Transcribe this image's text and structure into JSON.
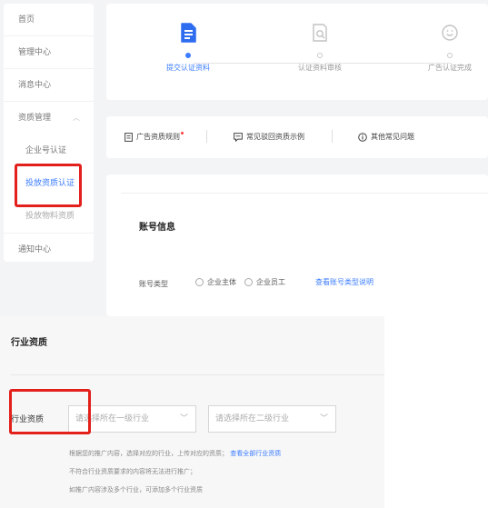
{
  "sidebar": {
    "items": [
      {
        "label": "首页"
      },
      {
        "label": "管理中心"
      },
      {
        "label": "消息中心"
      }
    ],
    "group": {
      "label": "资质管理",
      "expanded": true
    },
    "sub_items": [
      {
        "label": "企业号认证"
      },
      {
        "label": "投放资质认证",
        "active": true
      },
      {
        "label": "投放物料资质"
      }
    ],
    "footer_item": {
      "label": "通知中心"
    }
  },
  "steps": [
    {
      "label": "提交认证资料",
      "icon": "document-icon",
      "state": "current"
    },
    {
      "label": "认证资料审核",
      "icon": "document-search-icon",
      "state": "pending"
    },
    {
      "label": "广告认证完成",
      "icon": "smile-icon",
      "state": "pending"
    }
  ],
  "help_links": [
    {
      "label": "广告资质规则",
      "icon": "document-icon",
      "has_new_dot": true
    },
    {
      "label": "常见驳回资质示例",
      "icon": "message-icon"
    },
    {
      "label": "其他常见问题",
      "icon": "info-icon"
    }
  ],
  "account_section": {
    "title": "账号信息",
    "type_label": "账号类型",
    "options": [
      "企业主体",
      "企业员工"
    ],
    "help_link": "查看账号类型说明"
  },
  "industry_section": {
    "title": "行业资质",
    "label": "行业资质",
    "select_primary_placeholder": "请选择所在一级行业",
    "select_secondary_placeholder": "请选择所在二级行业",
    "hint_line1": "根据您的推广内容，选择对应的行业，上传对应的资质；",
    "hint_link": "查看全部行业资质",
    "hint_line2": "不符合行业资质要求的内容将无法进行推广；",
    "hint_line3": "如推广内容涉及多个行业，可添加多个行业资质"
  },
  "colors": {
    "accent": "#3b7cff",
    "highlight": "#e2201c"
  }
}
